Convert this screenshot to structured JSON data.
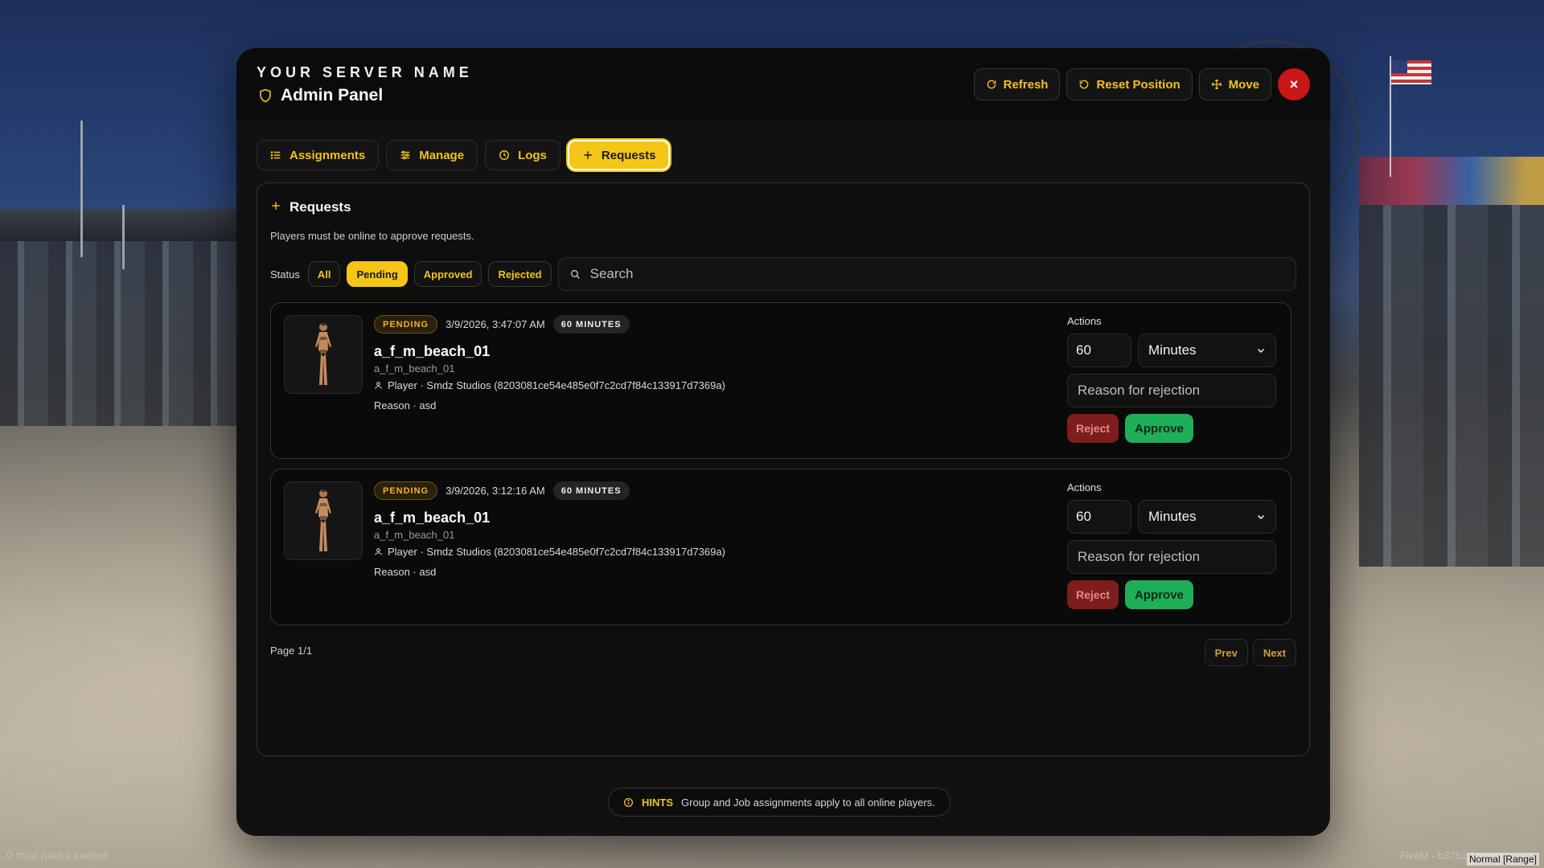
{
  "overlay": {
    "left_text": "0 mod packs loaded",
    "right_text": "FiveM - b3751 / canary",
    "corner_text": "Normal [Range]"
  },
  "panel": {
    "server_name": "YOUR SERVER NAME",
    "title": "Admin Panel",
    "header_buttons": {
      "refresh": "Refresh",
      "reset_position": "Reset Position",
      "move": "Move"
    },
    "close_symbol": "×"
  },
  "tabs": [
    {
      "label": "Assignments",
      "icon": "list-icon"
    },
    {
      "label": "Manage",
      "icon": "sliders-icon"
    },
    {
      "label": "Logs",
      "icon": "clock-icon"
    },
    {
      "label": "Requests",
      "icon": "plus-icon",
      "active": true
    }
  ],
  "requests": {
    "title": "Requests",
    "subtitle": "Players must be online to approve requests.",
    "status_label": "Status",
    "filters": [
      "All",
      "Pending",
      "Approved",
      "Rejected"
    ],
    "active_filter": "Pending",
    "search_placeholder": "Search",
    "actions_label": "Actions",
    "items": [
      {
        "status": "PENDING",
        "date": "3/9/2026, 3:47:07 AM",
        "duration": "60 MINUTES",
        "model": "a_f_m_beach_01",
        "model_sub": "a_f_m_beach_01",
        "player": "Player · Smdz Studios (8203081ce54e485e0f7c2cd7f84c133917d7369a)",
        "reason": "Reason · asd",
        "amount": "60",
        "unit": "Minutes",
        "reason_placeholder": "Reason for rejection",
        "reject_label": "Reject",
        "approve_label": "Approve"
      },
      {
        "status": "PENDING",
        "date": "3/9/2026, 3:12:16 AM",
        "duration": "60 MINUTES",
        "model": "a_f_m_beach_01",
        "model_sub": "a_f_m_beach_01",
        "player": "Player · Smdz Studios (8203081ce54e485e0f7c2cd7f84c133917d7369a)",
        "reason": "Reason · asd",
        "amount": "60",
        "unit": "Minutes",
        "reason_placeholder": "Reason for rejection",
        "reject_label": "Reject",
        "approve_label": "Approve"
      }
    ],
    "pagination": {
      "text": "Page 1/1",
      "prev": "Prev",
      "next": "Next"
    }
  },
  "hints": {
    "label": "HINTS",
    "text": "Group and Job assignments apply to all online players."
  },
  "colors": {
    "accent": "#f5c518",
    "panel_bg": "#111111",
    "approve": "#1fae59",
    "reject": "#7e1d1d",
    "close": "#c81717"
  }
}
